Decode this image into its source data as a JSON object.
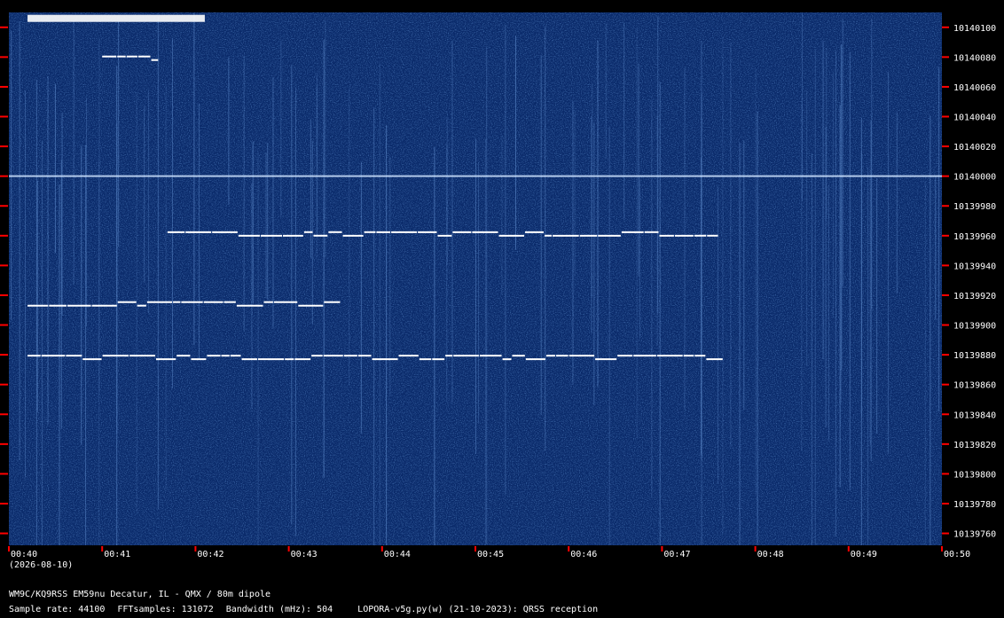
{
  "chart_data": {
    "type": "heatmap",
    "x_ticks": [
      "00:40",
      "00:41",
      "00:42",
      "00:43",
      "00:44",
      "00:45",
      "00:46",
      "00:47",
      "00:48",
      "00:49",
      "00:50"
    ],
    "x_sub": "(2026-08-10)",
    "y_ticks": [
      10140100,
      10140080,
      10140060,
      10140040,
      10140020,
      10140000,
      10139980,
      10139960,
      10139940,
      10139920,
      10139900,
      10139880,
      10139860,
      10139840,
      10139820,
      10139800,
      10139780,
      10139760
    ],
    "ylim": [
      10139752,
      10140110
    ],
    "xlim_minutes": [
      0,
      10
    ],
    "background_color": "#0a2a6a",
    "trace_color": "#ffffff",
    "tick_color": "#ff0000",
    "signals": [
      {
        "freq": 10140000,
        "start": 0.0,
        "end": 10.0,
        "pattern": "steady-carrier"
      },
      {
        "freq": 10139877,
        "start": 0.2,
        "end": 7.65,
        "pattern": "fsk-dashes"
      },
      {
        "freq": 10139913,
        "start": 0.2,
        "end": 3.55,
        "pattern": "fsk-dashes"
      },
      {
        "freq": 10139960,
        "start": 1.7,
        "end": 7.6,
        "pattern": "fsk-dashes"
      },
      {
        "freq": 10140078,
        "start": 1.0,
        "end": 1.6,
        "pattern": "fsk-dashes"
      },
      {
        "freq": 10140106,
        "start": 0.2,
        "end": 2.1,
        "pattern": "burst"
      }
    ]
  },
  "footer": {
    "line1": "WM9C/KQ9RSS EM59nu Decatur, IL - QMX / 80m dipole",
    "sample_rate": "Sample rate: 44100",
    "fft": "FFTsamples: 131072",
    "bandwidth": "Bandwidth (mHz): 504",
    "software": "LOPORA-v5g.py(w) (21-10-2023): QRSS reception"
  }
}
